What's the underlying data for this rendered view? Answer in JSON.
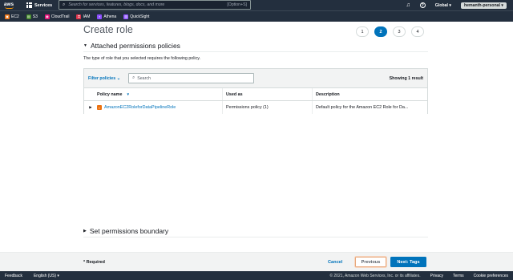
{
  "topnav": {
    "logo": "aws",
    "services_label": "Services",
    "search_placeholder": "Search for services, features, blogs, docs, and more",
    "search_shortcut": "[Option+S]",
    "region": "Global ▾",
    "account": "hemanth-personal ▾"
  },
  "favorites": [
    {
      "label": "EC2",
      "color": "#ec7211",
      "icon": "ec2-icon"
    },
    {
      "label": "S3",
      "color": "#3f8624",
      "icon": "s3-icon"
    },
    {
      "label": "CloudTrail",
      "color": "#e7157b",
      "icon": "cloudtrail-icon"
    },
    {
      "label": "IAM",
      "color": "#dd344c",
      "icon": "iam-icon"
    },
    {
      "label": "Athena",
      "color": "#8c4fff",
      "icon": "athena-icon"
    },
    {
      "label": "QuickSight",
      "color": "#8c4fff",
      "icon": "quicksight-icon"
    }
  ],
  "page": {
    "title": "Create role",
    "steps": [
      "1",
      "2",
      "3",
      "4"
    ],
    "active_step": "2"
  },
  "attached": {
    "heading": "Attached permissions policies",
    "description": "The type of role that you selected requires the following policy."
  },
  "table": {
    "filter_label": "Filter policies",
    "search_placeholder": "Search",
    "showing": "Showing 1 result",
    "columns": {
      "policy_name": "Policy name",
      "used_as": "Used as",
      "description": "Description"
    },
    "rows": [
      {
        "policy_name": "AmazonEC2RoleforDataPipelineRole",
        "used_as": "Permissions policy (1)",
        "description": "Default policy for the Amazon EC2 Role for Da..."
      }
    ]
  },
  "boundary": {
    "heading": "Set permissions boundary"
  },
  "wizard_footer": {
    "required": "* Required",
    "cancel": "Cancel",
    "previous": "Previous",
    "next": "Next: Tags"
  },
  "bottombar": {
    "feedback": "Feedback",
    "language": "English (US) ▾",
    "copyright": "© 2021, Amazon Web Services, Inc. or its affiliates.",
    "privacy": "Privacy",
    "terms": "Terms",
    "cookies": "Cookie preferences"
  },
  "colors": {
    "nav_bg": "#232f3e",
    "accent": "#0073bb",
    "policy_icon": "#ec7211"
  }
}
